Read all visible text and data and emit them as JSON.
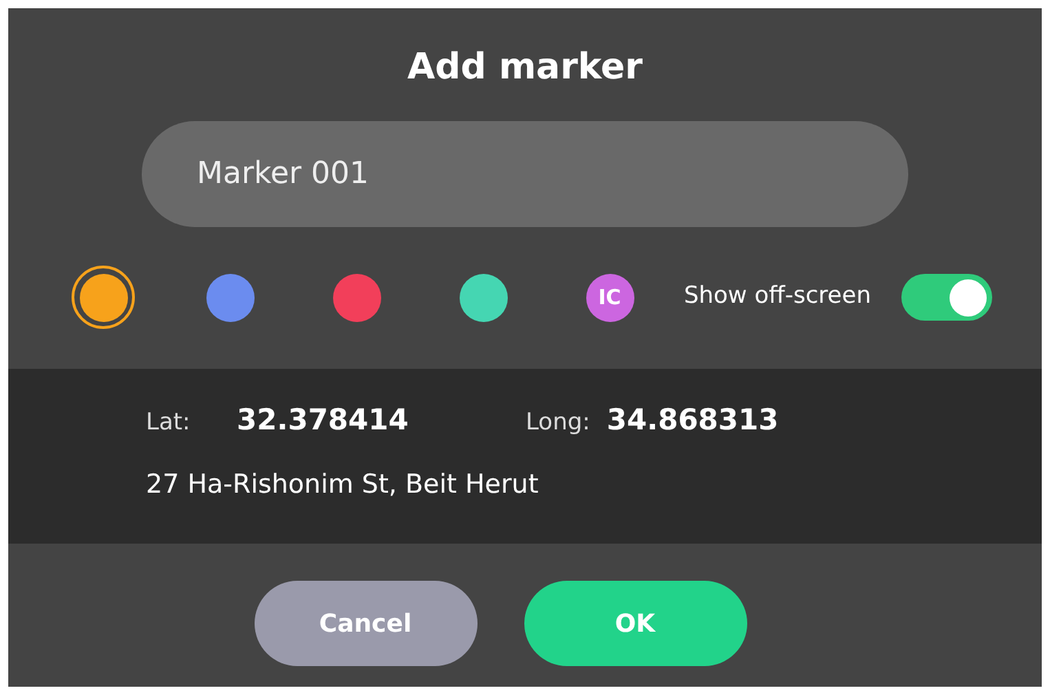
{
  "dialog": {
    "title": "Add marker"
  },
  "name_field": {
    "value": "Marker 001"
  },
  "colors": [
    {
      "kind": "dot",
      "color": "#f7a21b",
      "selected": true
    },
    {
      "kind": "dot",
      "color": "#6b8cef",
      "selected": false
    },
    {
      "kind": "dot",
      "color": "#f23f5a",
      "selected": false
    },
    {
      "kind": "dot",
      "color": "#45d6b2",
      "selected": false
    },
    {
      "kind": "initials",
      "color": "#cc66e0",
      "selected": false,
      "label": "IC"
    }
  ],
  "show_off_screen": {
    "label": "Show off-screen",
    "on": true
  },
  "location": {
    "lat_label": "Lat:",
    "lat": "32.378414",
    "long_label": "Long:",
    "long": "34.868313",
    "address": "27 Ha-Rishonim St, Beit Herut"
  },
  "buttons": [
    {
      "kind": "cancel",
      "label": "Cancel"
    },
    {
      "kind": "ok",
      "label": "OK"
    }
  ]
}
